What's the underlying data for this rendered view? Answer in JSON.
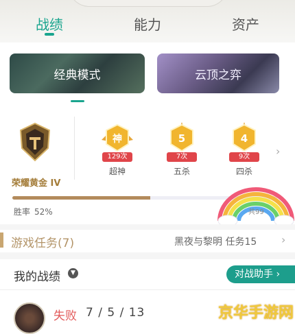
{
  "tabs": [
    {
      "label": "战绩",
      "active": true
    },
    {
      "label": "能力",
      "active": false
    },
    {
      "label": "资产",
      "active": false
    }
  ],
  "modes": [
    {
      "label": "经典模式",
      "selected": true
    },
    {
      "label": "云顶之弈",
      "selected": false
    }
  ],
  "rank": {
    "label": "荣耀黄金 IV"
  },
  "badges": [
    {
      "icon_char": "神",
      "count": "129次",
      "label": "超神",
      "color": "#f1b52e"
    },
    {
      "icon_char": "5",
      "count": "7次",
      "label": "五杀",
      "color": "#f1b52e"
    },
    {
      "icon_char": "4",
      "count": "9次",
      "label": "四杀",
      "color": "#f1b52e"
    }
  ],
  "winrate": {
    "label": "胜率",
    "value": "52%",
    "fraction": 0.52
  },
  "rainbow_text": "共99",
  "task": {
    "title": "游戏任务(7)",
    "right": "黑夜与黎明 任务15",
    "chevron": "›"
  },
  "my_record": {
    "title": "我的战绩",
    "helper_button": "对战助手"
  },
  "match": {
    "result": "失败",
    "kda": "7 / 5 / 13"
  },
  "watermark": "京华手游网",
  "colors": {
    "accent": "#1aa58e",
    "gold": "#b38b5c",
    "loss": "#e25b5b"
  }
}
